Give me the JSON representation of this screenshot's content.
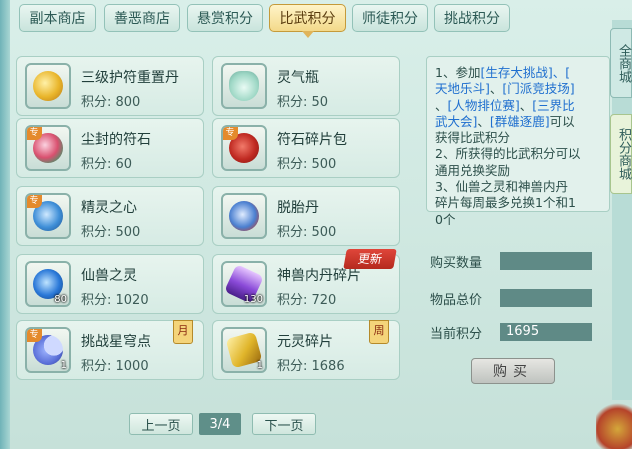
{
  "tabs": [
    {
      "label": "副本商店",
      "active": false
    },
    {
      "label": "善恶商店",
      "active": false
    },
    {
      "label": "悬赏积分",
      "active": false
    },
    {
      "label": "比武积分",
      "active": true
    },
    {
      "label": "师徒积分",
      "active": false
    },
    {
      "label": "挑战积分",
      "active": false
    }
  ],
  "right_tabs": {
    "tab1": "全商城",
    "tab2": "积分商城"
  },
  "items": [
    {
      "name": "三级护符重置丹",
      "price": "积分: 800",
      "icon": "gold-medal-icon",
      "color": "#e9b52a",
      "zhuan": false,
      "qty": ""
    },
    {
      "name": "灵气瓶",
      "price": "积分: 50",
      "icon": "potion-bottle-icon",
      "color": "#bfe6d9",
      "zhuan": false,
      "qty": ""
    },
    {
      "name": "尘封的符石",
      "price": "积分: 60",
      "icon": "gem-stone-icon",
      "color": "#d9506f",
      "zhuan": true,
      "qty": ""
    },
    {
      "name": "符石碎片包",
      "price": "积分: 500",
      "icon": "red-pouch-icon",
      "color": "#c02a22",
      "zhuan": true,
      "qty": ""
    },
    {
      "name": "精灵之心",
      "price": "积分: 500",
      "icon": "spirit-heart-icon",
      "color": "#3f8fd8",
      "zhuan": true,
      "qty": ""
    },
    {
      "name": "脱胎丹",
      "price": "积分: 500",
      "icon": "pill-icon",
      "color": "#4a7fd0",
      "zhuan": false,
      "qty": ""
    },
    {
      "name": "仙兽之灵",
      "price": "积分: 1020",
      "icon": "blue-orb-icon",
      "color": "#2a78d8",
      "zhuan": false,
      "qty": "80"
    },
    {
      "name": "神兽内丹碎片",
      "price": "积分: 720",
      "icon": "crystal-shard-icon",
      "color": "#8a4ad8",
      "zhuan": false,
      "qty": "130"
    },
    {
      "name": "挑战星穹点",
      "price": "积分: 1000",
      "icon": "crescent-moon-icon",
      "color": "#5a6fd8",
      "zhuan": true,
      "qty": "1",
      "ribbon": "月"
    },
    {
      "name": "元灵碎片",
      "price": "积分: 1686",
      "icon": "gold-fragment-icon",
      "color": "#e0b52a",
      "zhuan": false,
      "qty": "1",
      "ribbon": "周"
    }
  ],
  "badge_new": "更新",
  "pagination": {
    "prev": "上一页",
    "page": "3/4",
    "next": "下一页"
  },
  "info": {
    "l1_a": "1、参加",
    "l1_h1": "[生存大挑战]",
    "l1_b": "、[",
    "l2_h": "天地乐斗]",
    "l2_b": "、",
    "l2_h2": "[门派竞技场]",
    "l3_a": "、",
    "l3_h": "[人物排位赛]",
    "l3_b": "、",
    "l3_h2": "[三界比",
    "l4_h": "武大会]",
    "l4_b": "、",
    "l4_h2": "[群雄逐鹿]",
    "l4_c": "可以",
    "l5": "获得比武积分",
    "l6": "2、所获得的比武积分可以",
    "l7": "通用兑换奖励",
    "l8": "3、仙兽之灵和神兽内丹",
    "l9": "碎片每周最多兑换1个和1",
    "l10": "0个"
  },
  "fields": {
    "qty_label": "购买数量",
    "qty_value": "",
    "total_label": "物品总价",
    "total_value": "",
    "current_label": "当前积分",
    "current_value": "1695"
  },
  "buy_label": "购买"
}
